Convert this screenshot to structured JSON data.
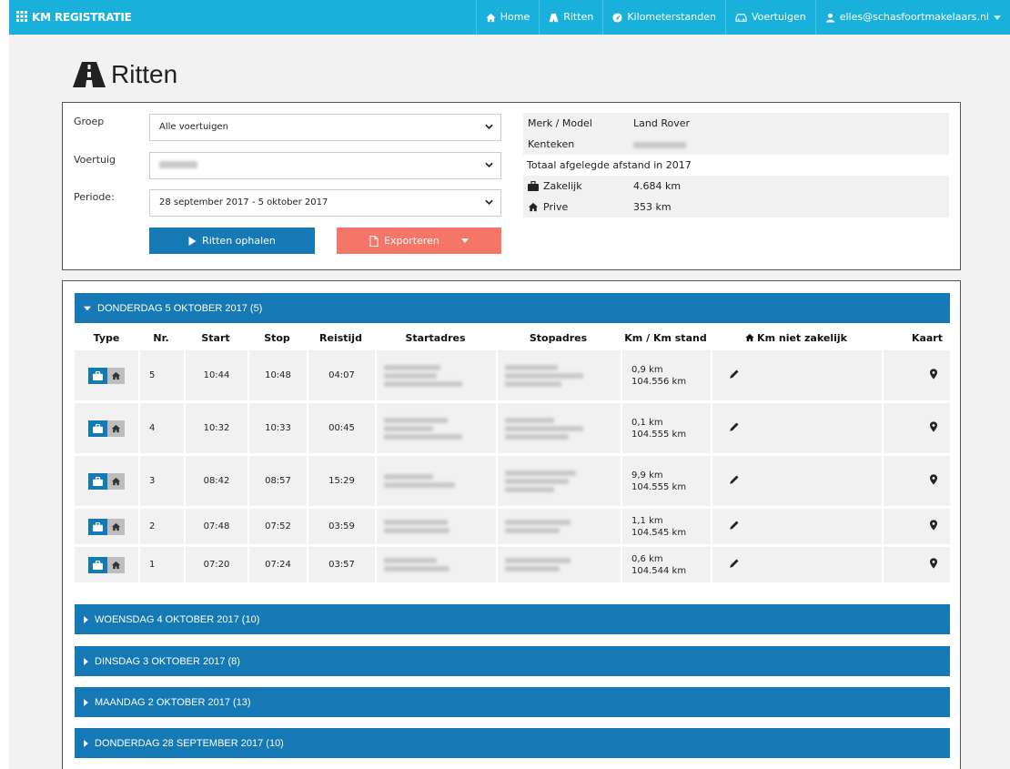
{
  "app": {
    "title": "KM REGISTRATIE"
  },
  "nav": [
    {
      "label": "Home",
      "icon": "home-icon"
    },
    {
      "label": "Ritten",
      "icon": "road-icon"
    },
    {
      "label": "Kilometerstanden",
      "icon": "dashboard-icon"
    },
    {
      "label": "Voertuigen",
      "icon": "car-icon"
    },
    {
      "label": "elles@schasfoortmakelaars.nl",
      "icon": "user-icon"
    }
  ],
  "page": {
    "title": "Ritten"
  },
  "filters": {
    "groep_label": "Groep",
    "groep_value": "Alle voertuigen",
    "voertuig_label": "Voertuig",
    "periode_label": "Periode:",
    "periode_value": "28 september 2017 - 5 oktober 2017",
    "fetch_button": "Ritten ophalen",
    "export_button": "Exporteren"
  },
  "vehicle_info": {
    "merk_label": "Merk / Model",
    "merk_value": "Land Rover",
    "kenteken_label": "Kenteken",
    "total_label": "Totaal afgelegde afstand in 2017",
    "zakelijk_label": "Zakelijk",
    "zakelijk_value": "4.684 km",
    "prive_label": "Prive",
    "prive_value": "353 km"
  },
  "table_headers": {
    "type": "Type",
    "nr": "Nr.",
    "start": "Start",
    "stop": "Stop",
    "reistijd": "Reistijd",
    "startadres": "Startadres",
    "stopadres": "Stopadres",
    "km": "Km / Km stand",
    "niet_zakelijk": "Km niet zakelijk",
    "kaart": "Kaart"
  },
  "days": [
    {
      "label": "DONDERDAG 5 OKTOBER 2017 (5)",
      "expanded": true
    },
    {
      "label": "WOENSDAG 4 OKTOBER 2017 (10)",
      "expanded": false
    },
    {
      "label": "DINSDAG 3 OKTOBER 2017 (8)",
      "expanded": false
    },
    {
      "label": "MAANDAG 2 OKTOBER 2017 (13)",
      "expanded": false
    },
    {
      "label": "DONDERDAG 28 SEPTEMBER 2017 (10)",
      "expanded": false
    }
  ],
  "trips": [
    {
      "nr": "5",
      "start": "10:44",
      "stop": "10:48",
      "reistijd": "04:07",
      "km": "0,9 km",
      "km_stand": "104.556 km"
    },
    {
      "nr": "4",
      "start": "10:32",
      "stop": "10:33",
      "reistijd": "00:45",
      "km": "0,1 km",
      "km_stand": "104.555 km"
    },
    {
      "nr": "3",
      "start": "08:42",
      "stop": "08:57",
      "reistijd": "15:29",
      "km": "9,9 km",
      "km_stand": "104.555 km"
    },
    {
      "nr": "2",
      "start": "07:48",
      "stop": "07:52",
      "reistijd": "03:59",
      "km": "1,1 km",
      "km_stand": "104.545 km"
    },
    {
      "nr": "1",
      "start": "07:20",
      "stop": "07:24",
      "reistijd": "03:57",
      "km": "0,6 km",
      "km_stand": "104.544 km"
    }
  ],
  "colors": {
    "topbar": "#1ab0dc",
    "primary": "#1479b4",
    "export": "#f57668"
  }
}
